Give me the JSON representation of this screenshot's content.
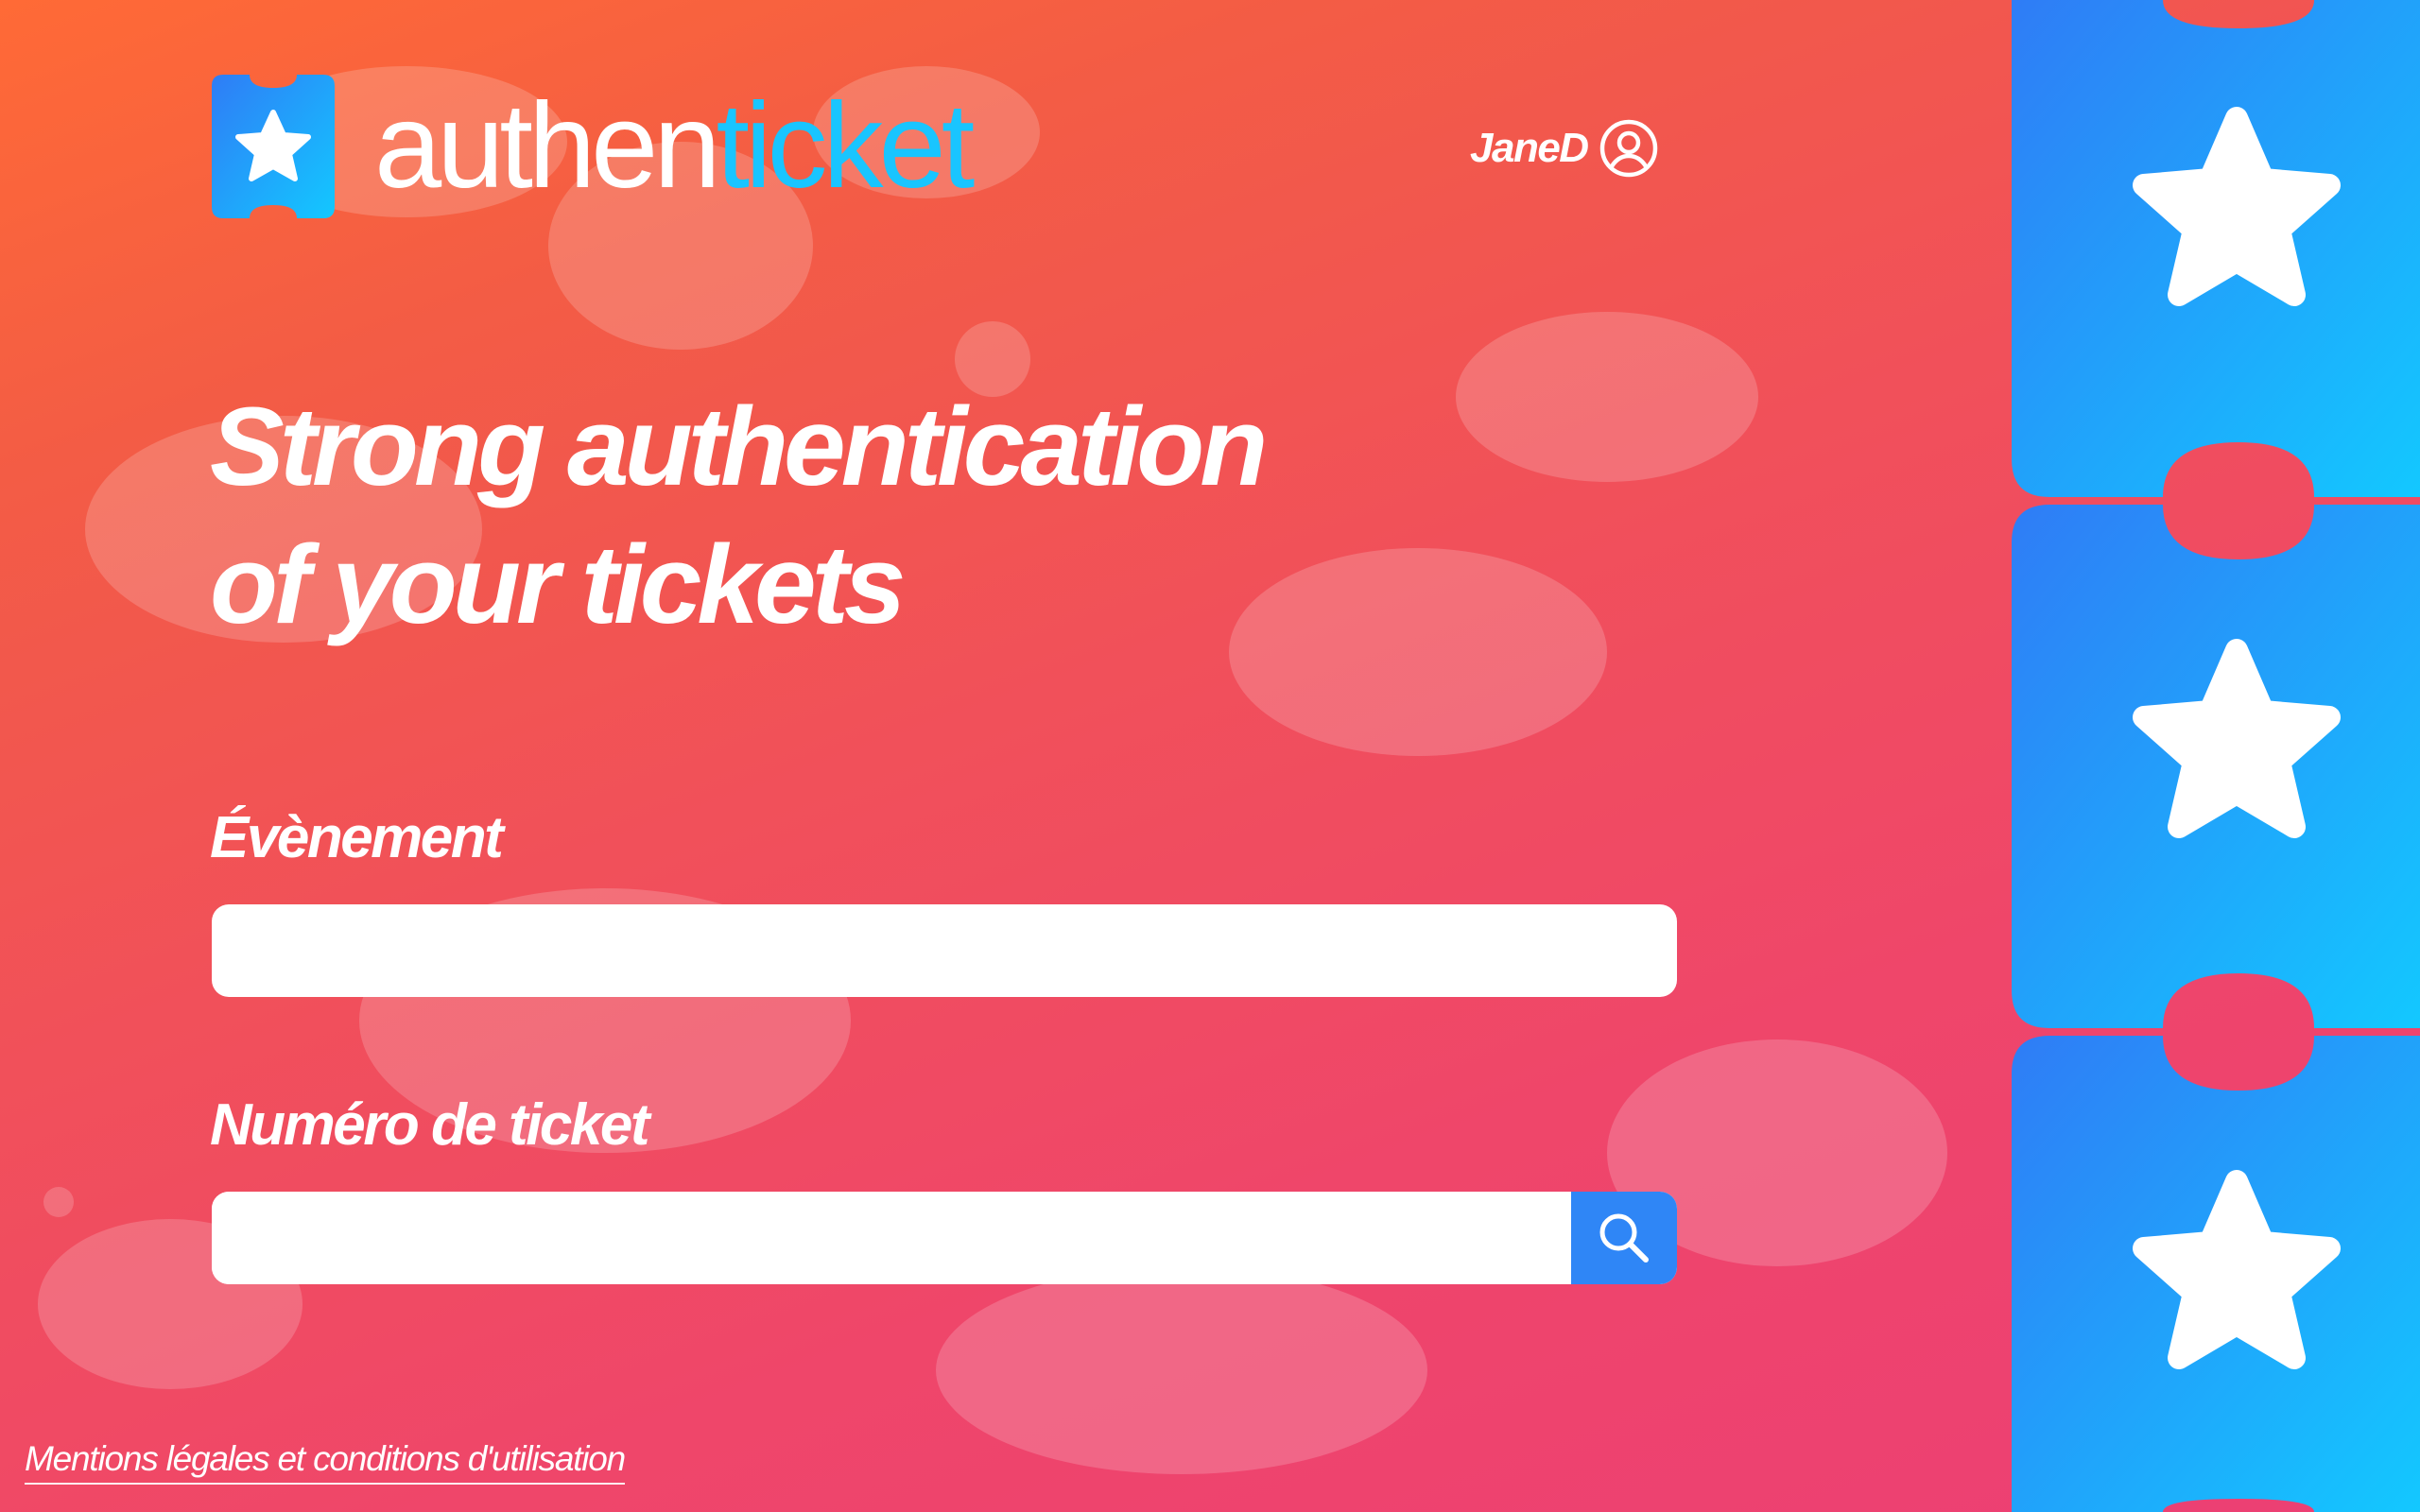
{
  "brand": {
    "name_part1": "authen",
    "name_part2": "ticket",
    "logo_icon": "ticket-star-icon",
    "accent_color": "#19c5ff",
    "icon_color": "#2f86f6"
  },
  "header": {
    "username": "JaneD",
    "user_icon": "user-circle-icon"
  },
  "hero": {
    "title_line1": "Strong authentication",
    "title_line2": "of your tickets"
  },
  "form": {
    "event_label": "Évènement",
    "event_value": "",
    "ticket_label": "Numéro de ticket",
    "ticket_value": "",
    "search_icon": "search-icon",
    "search_button_color": "#2f86f6"
  },
  "footer": {
    "legal_link": "Mentions légales et conditions d'utilisation"
  },
  "decor": {
    "ticket_strip_icons": [
      "star-icon",
      "star-icon",
      "star-icon"
    ],
    "gradient_colors": [
      "#ff6a36",
      "#ec3f74"
    ]
  }
}
